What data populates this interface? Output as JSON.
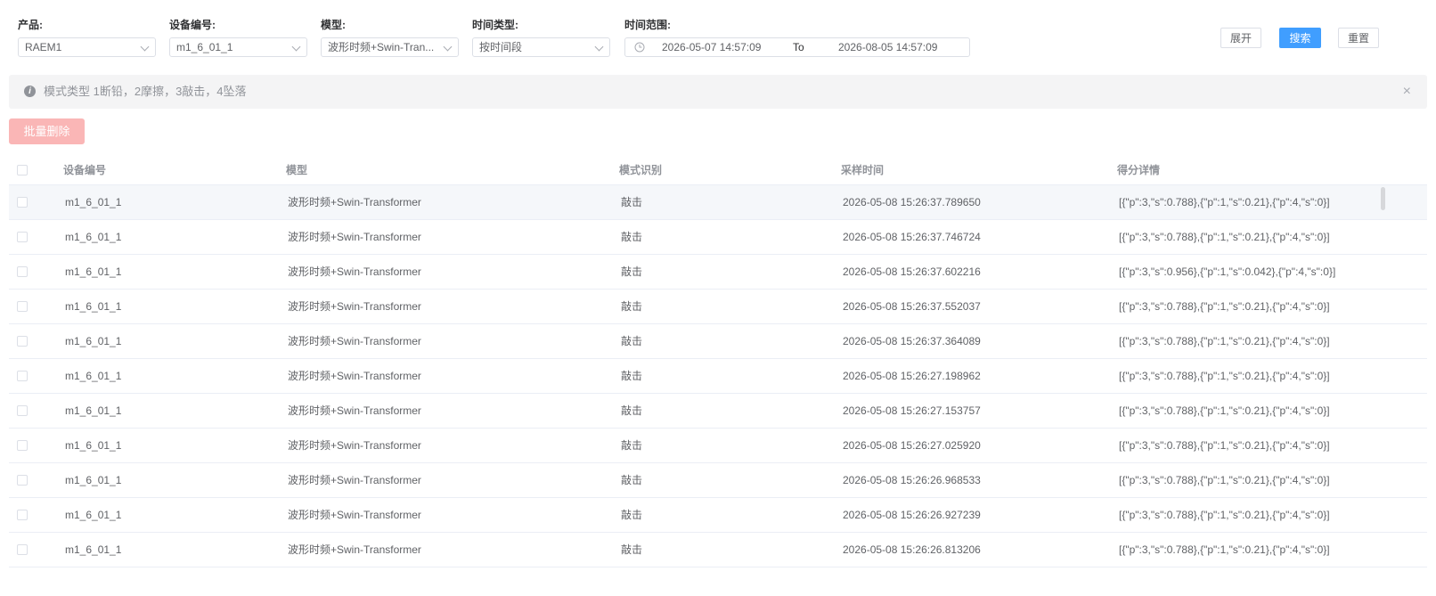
{
  "filters": {
    "product": {
      "label": "产品:",
      "value": "RAEM1"
    },
    "device": {
      "label": "设备编号:",
      "value": "m1_6_01_1"
    },
    "model": {
      "label": "模型:",
      "value": "波形时频+Swin-Tran..."
    },
    "time_type": {
      "label": "时间类型:",
      "value": "按时间段"
    },
    "time_range": {
      "label": "时间范围:",
      "start": "2026-05-07 14:57:09",
      "separator": "To",
      "end": "2026-08-05 14:57:09"
    }
  },
  "buttons": {
    "expand": "展开",
    "search": "搜索",
    "reset": "重置",
    "batch_delete": "批量删除"
  },
  "alert": {
    "message": "模式类型 1断铅，2摩擦，3敲击，4坠落",
    "close": "×"
  },
  "table": {
    "columns": [
      "设备编号",
      "模型",
      "模式识别",
      "采样时间",
      "得分详情"
    ],
    "rows": [
      [
        "m1_6_01_1",
        "波形时频+Swin-Transformer",
        "敲击",
        "2026-05-08 15:26:37.789650",
        "[{\"p\":3,\"s\":0.788},{\"p\":1,\"s\":0.21},{\"p\":4,\"s\":0}]"
      ],
      [
        "m1_6_01_1",
        "波形时频+Swin-Transformer",
        "敲击",
        "2026-05-08 15:26:37.746724",
        "[{\"p\":3,\"s\":0.788},{\"p\":1,\"s\":0.21},{\"p\":4,\"s\":0}]"
      ],
      [
        "m1_6_01_1",
        "波形时频+Swin-Transformer",
        "敲击",
        "2026-05-08 15:26:37.602216",
        "[{\"p\":3,\"s\":0.956},{\"p\":1,\"s\":0.042},{\"p\":4,\"s\":0}]"
      ],
      [
        "m1_6_01_1",
        "波形时频+Swin-Transformer",
        "敲击",
        "2026-05-08 15:26:37.552037",
        "[{\"p\":3,\"s\":0.788},{\"p\":1,\"s\":0.21},{\"p\":4,\"s\":0}]"
      ],
      [
        "m1_6_01_1",
        "波形时频+Swin-Transformer",
        "敲击",
        "2026-05-08 15:26:37.364089",
        "[{\"p\":3,\"s\":0.788},{\"p\":1,\"s\":0.21},{\"p\":4,\"s\":0}]"
      ],
      [
        "m1_6_01_1",
        "波形时频+Swin-Transformer",
        "敲击",
        "2026-05-08 15:26:27.198962",
        "[{\"p\":3,\"s\":0.788},{\"p\":1,\"s\":0.21},{\"p\":4,\"s\":0}]"
      ],
      [
        "m1_6_01_1",
        "波形时频+Swin-Transformer",
        "敲击",
        "2026-05-08 15:26:27.153757",
        "[{\"p\":3,\"s\":0.788},{\"p\":1,\"s\":0.21},{\"p\":4,\"s\":0}]"
      ],
      [
        "m1_6_01_1",
        "波形时频+Swin-Transformer",
        "敲击",
        "2026-05-08 15:26:27.025920",
        "[{\"p\":3,\"s\":0.788},{\"p\":1,\"s\":0.21},{\"p\":4,\"s\":0}]"
      ],
      [
        "m1_6_01_1",
        "波形时频+Swin-Transformer",
        "敲击",
        "2026-05-08 15:26:26.968533",
        "[{\"p\":3,\"s\":0.788},{\"p\":1,\"s\":0.21},{\"p\":4,\"s\":0}]"
      ],
      [
        "m1_6_01_1",
        "波形时频+Swin-Transformer",
        "敲击",
        "2026-05-08 15:26:26.927239",
        "[{\"p\":3,\"s\":0.788},{\"p\":1,\"s\":0.21},{\"p\":4,\"s\":0}]"
      ],
      [
        "m1_6_01_1",
        "波形时频+Swin-Transformer",
        "敲击",
        "2026-05-08 15:26:26.813206",
        "[{\"p\":3,\"s\":0.788},{\"p\":1,\"s\":0.21},{\"p\":4,\"s\":0}]"
      ]
    ]
  },
  "icons": {
    "select": "chevron-down-icon",
    "time": "clock-icon",
    "alert": "info-icon",
    "close": "close-icon"
  },
  "colors": {
    "primary": "#409eff",
    "danger_disabled": "#fab6b6",
    "alert_bg": "#f4f4f5",
    "row_hover": "#f5f7fa"
  }
}
